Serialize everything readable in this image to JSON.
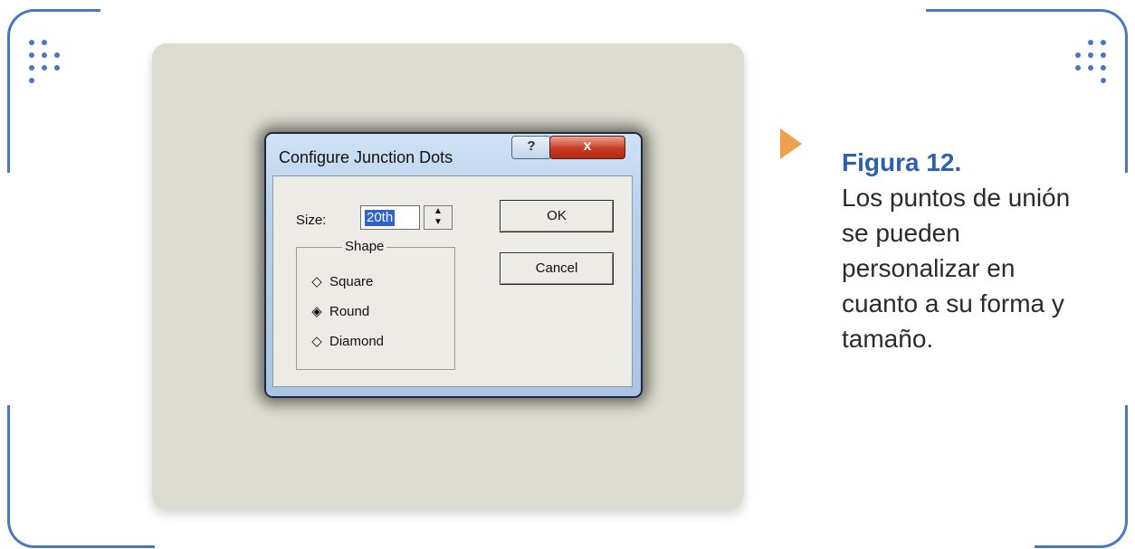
{
  "dialog": {
    "title": "Configure Junction Dots",
    "help_button": "?",
    "close_button": "x",
    "size_label": "Size:",
    "size_value": "20th",
    "shape_group_label": "Shape",
    "shape_options": [
      "Square",
      "Round",
      "Diamond"
    ],
    "selected_shape": "Round",
    "ok_label": "OK",
    "cancel_label": "Cancel"
  },
  "caption": {
    "title": "Figura 12.",
    "text": "Los puntos de unión se pueden personalizar en cuanto a su forma y tamaño."
  },
  "colors": {
    "frame": "#4a78c0",
    "panel": "#dddcd0",
    "arrow": "#f0a04b",
    "caption_title": "#2f5fb0",
    "selection": "#2f63c9",
    "close_button": "#c73a24"
  }
}
